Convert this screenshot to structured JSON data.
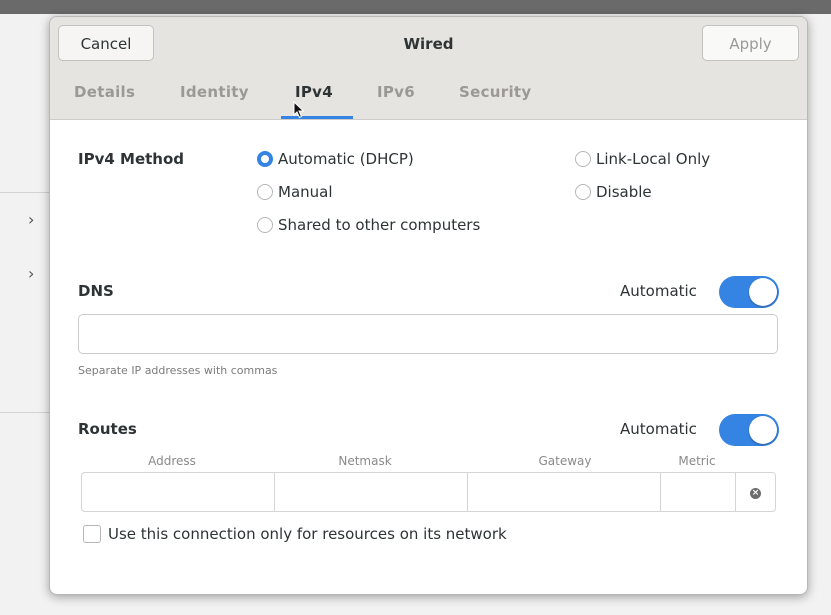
{
  "dialog": {
    "title": "Wired",
    "cancel_label": "Cancel",
    "apply_label": "Apply"
  },
  "tabs": [
    "Details",
    "Identity",
    "IPv4",
    "IPv6",
    "Security"
  ],
  "active_tab": "IPv4",
  "ipv4": {
    "method_label": "IPv4 Method",
    "methods": {
      "automatic": "Automatic (DHCP)",
      "manual": "Manual",
      "shared": "Shared to other computers",
      "link_local": "Link-Local Only",
      "disable": "Disable"
    },
    "selected_method": "Automatic (DHCP)"
  },
  "dns": {
    "label": "DNS",
    "automatic_label": "Automatic",
    "automatic_on": true,
    "value": "",
    "hint": "Separate IP addresses with commas"
  },
  "routes": {
    "label": "Routes",
    "automatic_label": "Automatic",
    "automatic_on": true,
    "columns": [
      "Address",
      "Netmask",
      "Gateway",
      "Metric"
    ]
  },
  "restrict_label": "Use this connection only for resources on its network",
  "restrict_checked": false,
  "colors": {
    "accent": "#3584e4"
  },
  "icons": [
    "chevron-right-icon",
    "cursor-icon",
    "remove-route-icon"
  ]
}
